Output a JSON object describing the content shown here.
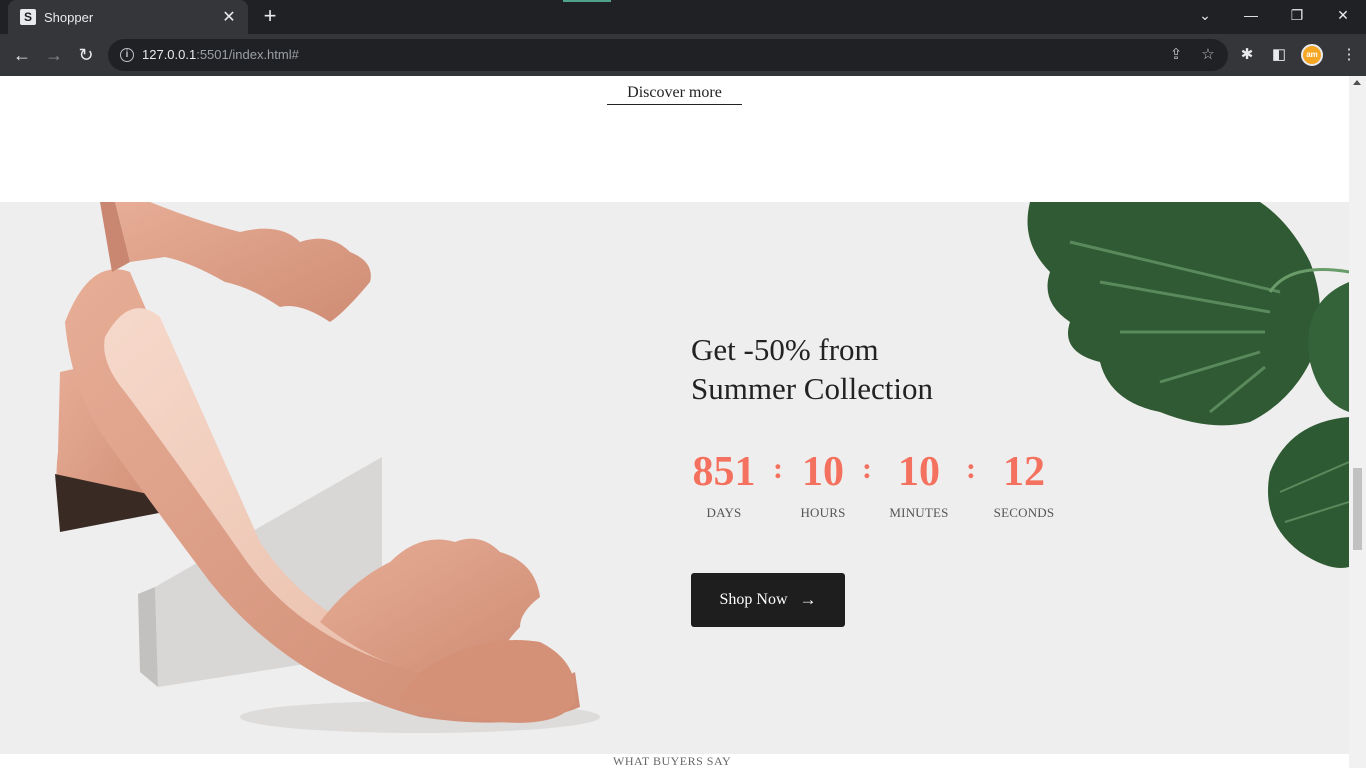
{
  "browser": {
    "tab_title": "Shopper",
    "tab_favicon_letter": "S",
    "new_tab_label": "+",
    "url_host": "127.0.0.1",
    "url_rest": ":5501/index.html#",
    "profile_initials": "am"
  },
  "page": {
    "discover_label": "Discover more",
    "promo": {
      "title_line1": "Get -50% from",
      "title_line2": "Summer Collection",
      "countdown": [
        {
          "value": "851",
          "label": "DAYS"
        },
        {
          "value": "10",
          "label": "HOURS"
        },
        {
          "value": "10",
          "label": "MINUTES"
        },
        {
          "value": "12",
          "label": "SECONDS"
        }
      ],
      "separator": ":",
      "shop_button_label": "Shop Now",
      "shop_button_arrow": "→"
    },
    "next_section_heading": "WHAT BUYERS SAY"
  },
  "colors": {
    "accent": "#f4715f",
    "button_bg": "#1e1e1e",
    "promo_bg": "#efeeee"
  }
}
